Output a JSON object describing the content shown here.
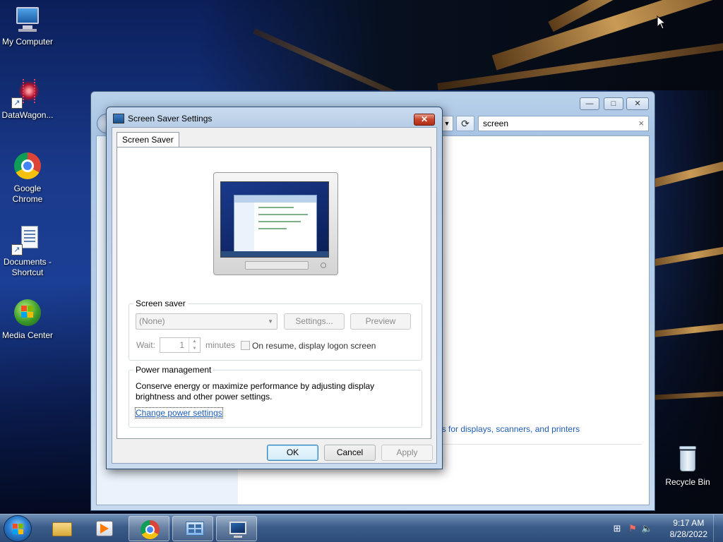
{
  "desktop": {
    "icons": [
      {
        "label": "My Computer",
        "icon": "computer-icon"
      },
      {
        "label": "DataWagon...",
        "icon": "datawagon-icon"
      },
      {
        "label": "Google Chrome",
        "icon": "chrome-icon"
      },
      {
        "label": "Documents - Shortcut",
        "icon": "documents-icon"
      },
      {
        "label": "Media Center",
        "icon": "media-center-icon"
      },
      {
        "label": "Recycle Bin",
        "icon": "recycle-bin-icon"
      }
    ]
  },
  "explorer": {
    "search_value": "screen",
    "link_text": "gs for displays, scanners, and printers",
    "controls": {
      "minimize": "—",
      "maximize": "□",
      "close": "✕"
    },
    "refresh_glyph": "⟳",
    "dropdown_glyph": "▼",
    "clear_glyph": "×"
  },
  "dialog": {
    "title": "Screen Saver Settings",
    "close_glyph": "✕",
    "tab": "Screen Saver",
    "screen_saver_group": {
      "label": "Screen saver",
      "selected": "(None)",
      "settings_button": "Settings...",
      "preview_button": "Preview",
      "wait_label": "Wait:",
      "wait_value": "1",
      "minutes_label": "minutes",
      "logon_checkbox_label": "On resume, display logon screen",
      "logon_checked": false
    },
    "power_group": {
      "label": "Power management",
      "description_line1": "Conserve energy or maximize performance by adjusting display",
      "description_line2": "brightness and other power settings.",
      "link": "Change power settings"
    },
    "buttons": {
      "ok": "OK",
      "cancel": "Cancel",
      "apply": "Apply"
    }
  },
  "taskbar": {
    "items": [
      "start-button",
      "file-explorer",
      "media-player",
      "chrome",
      "control-panel",
      "screen-saver-settings"
    ],
    "time": "9:17 AM",
    "date": "8/28/2022"
  },
  "colors": {
    "link": "#1e5cb3",
    "close_button": "#c6432b",
    "taskbar": "#3b5c89"
  }
}
